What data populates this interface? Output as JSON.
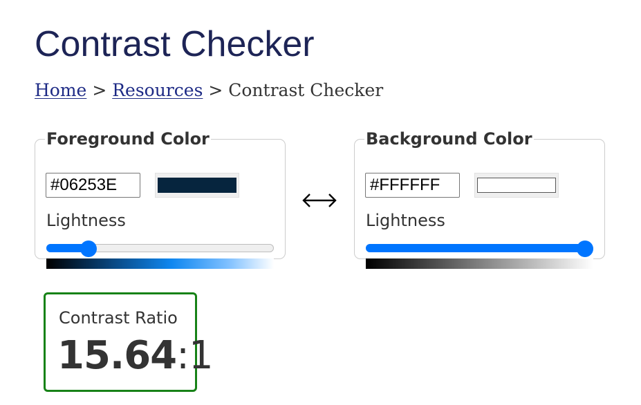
{
  "page": {
    "title": "Contrast Checker"
  },
  "breadcrumb": {
    "items": [
      {
        "label": "Home",
        "link": true
      },
      {
        "label": "Resources",
        "link": true
      },
      {
        "label": "Contrast Checker",
        "link": false
      }
    ],
    "separator": ">"
  },
  "foreground": {
    "legend": "Foreground Color",
    "hex_value": "#06253E",
    "swatch_color": "#06253E",
    "lightness_label": "Lightness",
    "lightness_percent": 16
  },
  "background": {
    "legend": "Background Color",
    "hex_value": "#FFFFFF",
    "swatch_color": "#FFFFFF",
    "lightness_label": "Lightness",
    "lightness_percent": 100
  },
  "swap": {
    "icon": "left-right-arrow-icon"
  },
  "result": {
    "label": "Contrast Ratio",
    "ratio": "15.64",
    "suffix": ":1"
  },
  "colors": {
    "title": "#1D2456",
    "link": "#1D2A85",
    "slider_accent": "#0075FF",
    "pass_border": "#178217"
  }
}
